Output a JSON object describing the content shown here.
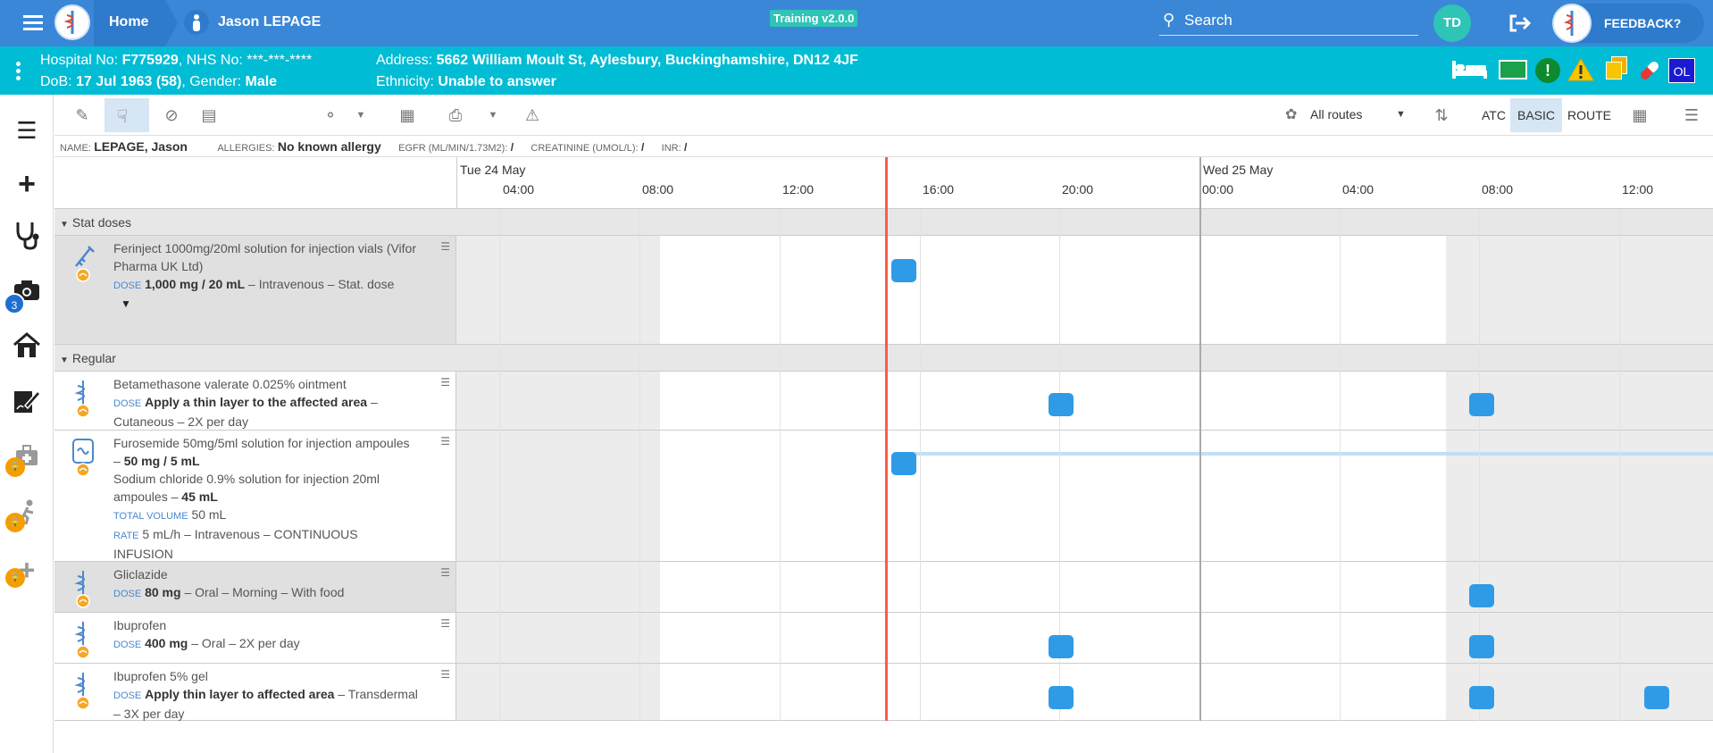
{
  "top": {
    "home": "Home",
    "patient": "Jason LEPAGE",
    "training": "Training v2.0.0",
    "search_placeholder": "Search",
    "user_initials": "TD",
    "feedback": "FEEDBACK?"
  },
  "pat": {
    "hosp_label": "Hospital No:",
    "hosp": "F775929",
    "nhs_label": ", NHS No:",
    "nhs": "***-***-****",
    "dob_label": "DoB:",
    "dob": "17 Jul 1963 (58)",
    "gender_label": ", Gender:",
    "gender": "Male",
    "addr_label": "Address:",
    "addr": "5662 William Moult St, Aylesbury, Buckinghamshire, DN12 4JF",
    "eth_label": "Ethnicity:",
    "eth": "Unable to answer",
    "ol": "OL"
  },
  "nav": {
    "badge": "3"
  },
  "toolbar": {
    "routes": "All routes",
    "atc": "ATC",
    "basic": "BASIC",
    "route": "ROUTE"
  },
  "info": {
    "name_label": "NAME:",
    "name": "LEPAGE, Jason",
    "allergy_label": "ALLERGIES:",
    "allergy": "No known allergy",
    "egfr_label": "EGFR (ML/MIN/1.73M2):",
    "egfr": "/",
    "creat_label": "CREATININE (UMOL/L):",
    "creat": "/",
    "inr_label": "INR:",
    "inr": "/"
  },
  "timeline": {
    "day1": "Tue 24 May",
    "day2": "Wed 25 May",
    "ticks": [
      "04:00",
      "08:00",
      "12:00",
      "16:00",
      "20:00",
      "00:00",
      "04:00",
      "08:00",
      "12:00"
    ]
  },
  "sections": {
    "stat": "Stat doses",
    "regular": "Regular"
  },
  "meds": {
    "m1": {
      "name": "Ferinject 1000mg/20ml solution for injection vials (Vifor Pharma UK Ltd)",
      "dose_label": "DOSE",
      "dose": "1,000 mg / 20 mL",
      "rest": "– Intravenous – Stat. dose"
    },
    "m2": {
      "name": "Betamethasone valerate 0.025% ointment",
      "dose_label": "DOSE",
      "dose": "Apply a thin layer to the affected area",
      "rest": "– Cutaneous – 2X per day"
    },
    "m3": {
      "name1": "Furosemide 50mg/5ml solution for injection ampoules –",
      "dose1": "50 mg / 5 mL",
      "name2": "Sodium chloride 0.9% solution for injection 20ml ampoules –",
      "dose2": "45 mL",
      "tv_label": "TOTAL VOLUME",
      "tv": "50 mL",
      "rate_label": "RATE",
      "rate": "5 mL/h – Intravenous – CONTINUOUS INFUSION"
    },
    "m4": {
      "name": "Gliclazide",
      "dose_label": "DOSE",
      "dose": "80 mg",
      "rest": "– Oral – Morning – With food"
    },
    "m5": {
      "name": "Ibuprofen",
      "dose_label": "DOSE",
      "dose": "400 mg",
      "rest": "– Oral – 2X per day"
    },
    "m6": {
      "name": "Ibuprofen 5% gel",
      "dose_label": "DOSE",
      "dose": "Apply thin layer to affected area",
      "rest": "– Transdermal – 3X per day"
    }
  },
  "colors": {
    "header": "#3a87d8",
    "patient_bar": "#00bcd4",
    "dose_block": "#2f9be6",
    "now_line": "#ff5a4a"
  }
}
